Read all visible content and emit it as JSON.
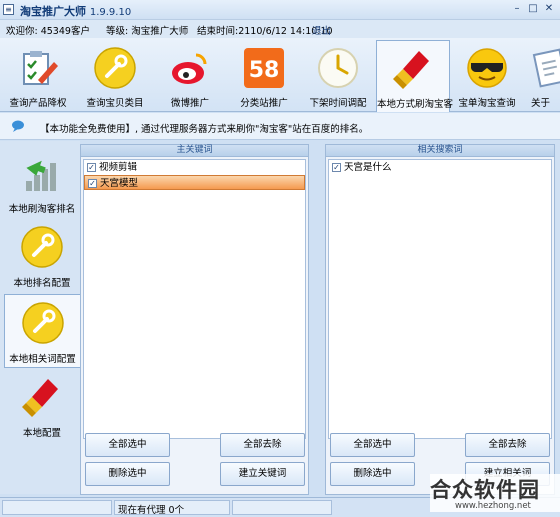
{
  "app": {
    "title": "淘宝推广大师",
    "version": "1.9.9.10"
  },
  "window": {
    "minimize": "–",
    "maximize": "□",
    "close": "✕"
  },
  "info": {
    "welcome": "欢迎你: 45349客户",
    "level": "等级: 淘宝推广大师",
    "end_time": "结束时间:2110/6/12 14:10:10",
    "logout": "退出"
  },
  "toolbar": [
    {
      "label": "查询产品降权",
      "icon": "clipboard-pencil-icon"
    },
    {
      "label": "查询宝贝类目",
      "icon": "wrench-icon"
    },
    {
      "label": "微博推广",
      "icon": "weibo-icon"
    },
    {
      "label": "分类站推广",
      "icon": "58-icon"
    },
    {
      "label": "下架时间调配",
      "icon": "clock-icon"
    },
    {
      "label": "本地方式刷淘宝客",
      "icon": "lipstick-icon"
    },
    {
      "label": "宝单淘宝查询",
      "icon": "sunglasses-face-icon"
    },
    {
      "label": "关于",
      "icon": "document-icon"
    }
  ],
  "notice": "【本功能全免费使用】, 通过代理服务器方式来刷你\"淘宝客\"站在百度的排名。",
  "leftnav": [
    {
      "label": "本地刷淘客排名",
      "icon": "bar-chart-arrow-icon"
    },
    {
      "label": "本地排名配置",
      "icon": "wrench-icon"
    },
    {
      "label": "本地相关词配置",
      "icon": "wrench-icon"
    },
    {
      "label": "本地配置",
      "icon": "lipstick-icon"
    }
  ],
  "main_keywords": {
    "header": "主关键词",
    "items": [
      "视频剪辑",
      "天宫模型"
    ],
    "select_all": "全部选中",
    "remove_all": "全部去除",
    "delete_selected": "删除选中",
    "create": "建立关键词"
  },
  "related_terms": {
    "header": "相关搜索词",
    "items": [
      "天宫是什么"
    ],
    "select_all": "全部选中",
    "remove_all": "全部去除",
    "delete_selected": "删除选中",
    "create": "建立相关词"
  },
  "status": {
    "proxies": "现在有代理 0个"
  },
  "watermark": {
    "big": "合众软件园",
    "small": "www.hezhong.net"
  },
  "colors": {
    "accent": "#f59a4f",
    "frame": "#cfe0f3",
    "title": "#123c78"
  }
}
